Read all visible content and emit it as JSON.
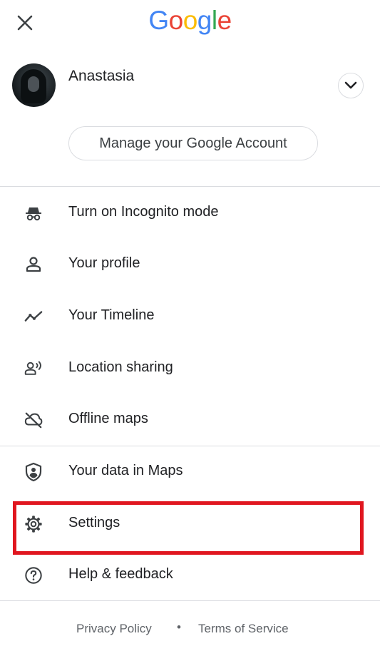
{
  "header": {
    "logo_letters": [
      {
        "ch": "G",
        "color": "#4285F4"
      },
      {
        "ch": "o",
        "color": "#EA4335"
      },
      {
        "ch": "o",
        "color": "#FBBC05"
      },
      {
        "ch": "g",
        "color": "#4285F4"
      },
      {
        "ch": "l",
        "color": "#34A853"
      },
      {
        "ch": "e",
        "color": "#EA4335"
      }
    ],
    "close_icon": "close-icon"
  },
  "account": {
    "name": "Anastasia",
    "manage_label": "Manage your Google Account",
    "switch_icon": "chevron-down-icon"
  },
  "menu": {
    "items": [
      {
        "label": "Turn on Incognito mode",
        "icon": "incognito-icon"
      },
      {
        "label": "Your profile",
        "icon": "person-icon"
      },
      {
        "label": "Your Timeline",
        "icon": "timeline-icon"
      },
      {
        "label": "Location sharing",
        "icon": "location-sharing-icon"
      },
      {
        "label": "Offline maps",
        "icon": "offline-cloud-icon"
      },
      {
        "label": "Your data in Maps",
        "icon": "shield-person-icon"
      },
      {
        "label": "Settings",
        "icon": "gear-icon"
      },
      {
        "label": "Help & feedback",
        "icon": "help-icon"
      }
    ]
  },
  "footer": {
    "privacy": "Privacy Policy",
    "separator": "•",
    "terms": "Terms of Service"
  },
  "colors": {
    "highlight": "#e0161f",
    "divider": "#dadce0",
    "text": "#202124",
    "icon": "#3c4043"
  }
}
